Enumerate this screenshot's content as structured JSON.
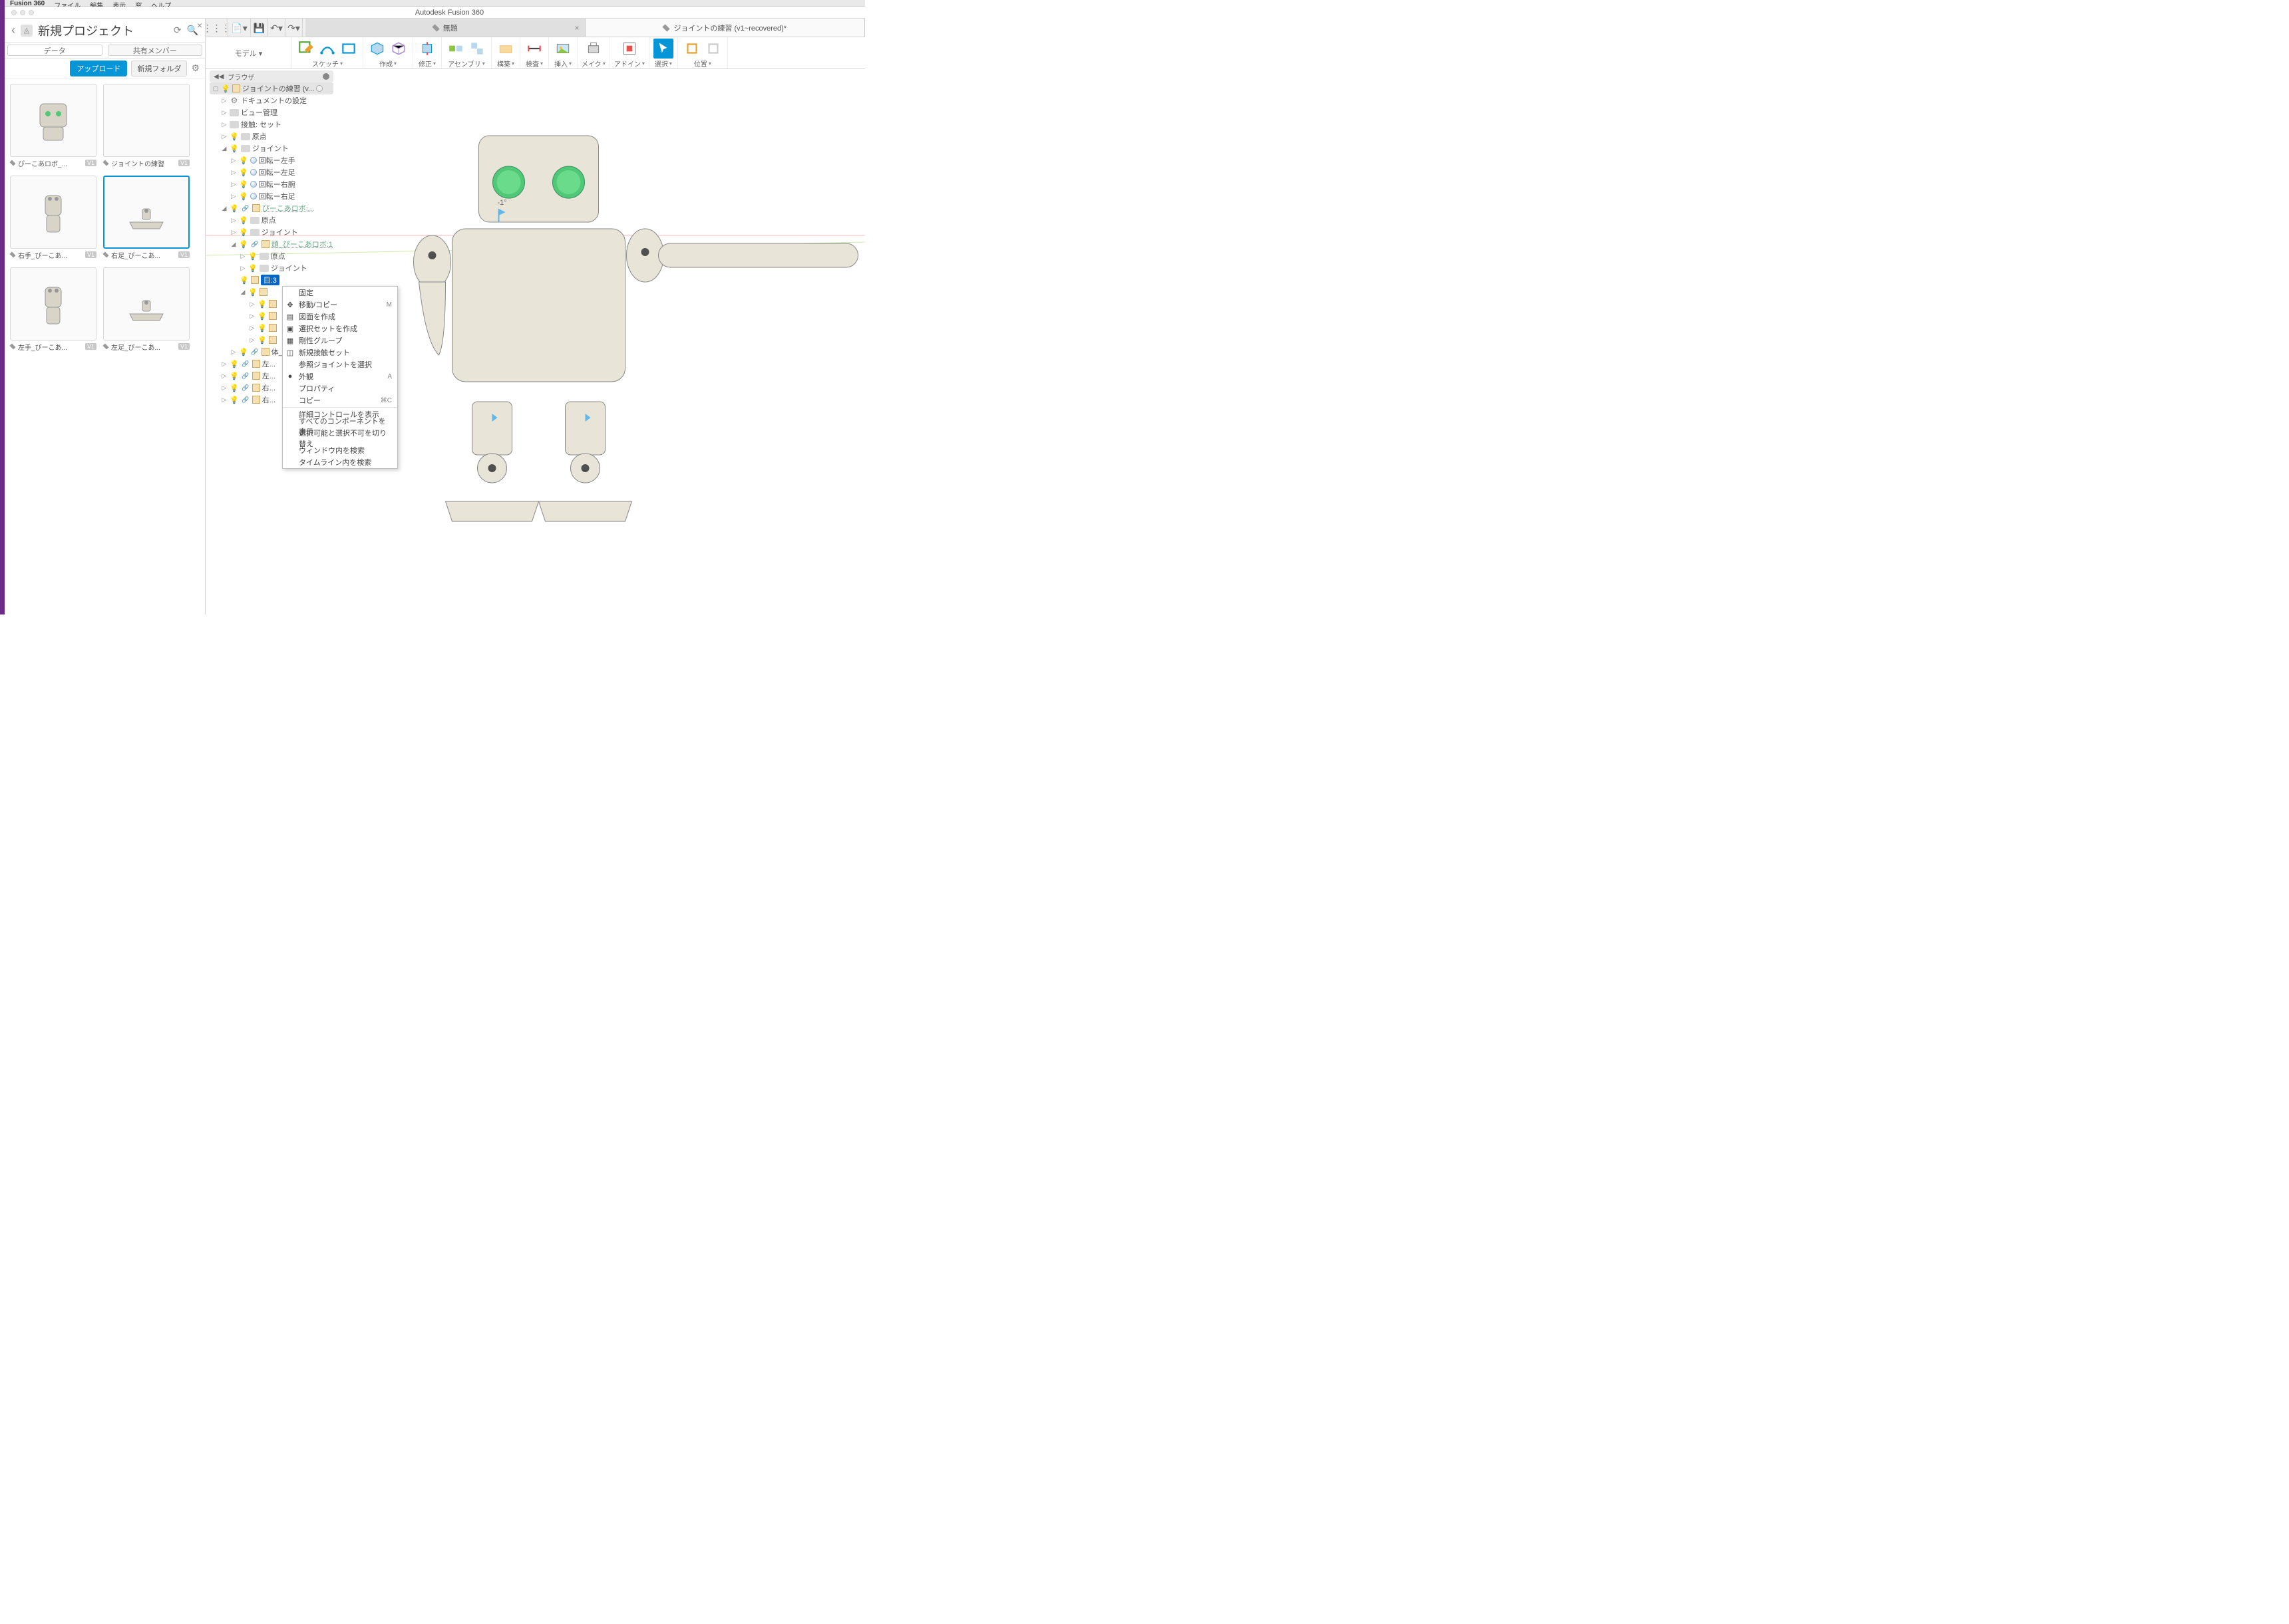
{
  "app": {
    "name": "Fusion 360",
    "window_title": "Autodesk Fusion 360"
  },
  "menubar": [
    "ファイル",
    "編集",
    "表示",
    "窓",
    "ヘルプ"
  ],
  "doc_tabs": [
    {
      "label": "無題",
      "active": false
    },
    {
      "label": "ジョイントの練習 (v1~recovered)*",
      "active": true
    }
  ],
  "workspace": "モデル ▾",
  "ribbon_groups": [
    {
      "label": "スケッチ"
    },
    {
      "label": "作成"
    },
    {
      "label": "修正"
    },
    {
      "label": "アセンブリ"
    },
    {
      "label": "構築"
    },
    {
      "label": "検査"
    },
    {
      "label": "挿入"
    },
    {
      "label": "メイク"
    },
    {
      "label": "アドイン"
    },
    {
      "label": "選択"
    },
    {
      "label": "位置"
    }
  ],
  "data_panel": {
    "project_title": "新規プロジェクト",
    "tabs": {
      "data": "データ",
      "members": "共有メンバー"
    },
    "upload": "アップロード",
    "new_folder": "新規フォルダ",
    "items": [
      {
        "name": "ぴーこあロボ_...",
        "ver": "V1",
        "kind": "robot-head"
      },
      {
        "name": "ジョイントの練習",
        "ver": "V1",
        "kind": "blank"
      },
      {
        "name": "右手_ぴーこあ...",
        "ver": "V1",
        "kind": "arm"
      },
      {
        "name": "右足_ぴーこあ...",
        "ver": "V1",
        "kind": "foot",
        "selected": true
      },
      {
        "name": "左手_ぴーこあ...",
        "ver": "V1",
        "kind": "arm"
      },
      {
        "name": "左足_ぴーこあ...",
        "ver": "V1",
        "kind": "foot"
      }
    ]
  },
  "browser": {
    "title": "ブラウザ",
    "root": "ジョイントの練習 (v...",
    "nodes": {
      "doc_settings": "ドキュメントの設定",
      "view_mgmt": "ビュー管理",
      "contact_set": "接触: セット",
      "origin": "原点",
      "joints": "ジョイント",
      "j_rot_lh": "回転ー左手",
      "j_rot_lf": "回転ー左足",
      "j_rot_rh": "回転ー右腕",
      "j_rot_rf": "回転ー右足",
      "comp_robo": "ぴーこあロボ:...",
      "comp_origin": "原点",
      "comp_joint": "ジョイント",
      "comp_head": "頭_ぴーこあロボ:1",
      "head_origin": "原点",
      "head_joint": "ジョイント",
      "head_eye": "目:3",
      "body": "体_...",
      "l_": "左...",
      "r_": "右..."
    }
  },
  "context_menu": [
    {
      "label": "固定"
    },
    {
      "label": "移動/コピー",
      "icon": "move",
      "shortcut": "M"
    },
    {
      "label": "図面を作成",
      "icon": "drawing"
    },
    {
      "label": "選択セットを作成",
      "icon": "selset"
    },
    {
      "label": "剛性グループ",
      "icon": "rigid"
    },
    {
      "label": "新規接触セット",
      "icon": "contact"
    },
    {
      "label": "参照ジョイントを選択"
    },
    {
      "label": "外観",
      "icon": "appearance",
      "shortcut": "A"
    },
    {
      "label": "プロパティ"
    },
    {
      "label": "コピー",
      "shortcut": "⌘C"
    },
    {
      "sep": true
    },
    {
      "label": "詳細コントロールを表示"
    },
    {
      "label": "すべてのコンポーネントを表示"
    },
    {
      "label": "選択可能と選択不可を切り替え"
    },
    {
      "label": "ウィンドウ内を検索"
    },
    {
      "label": "タイムライン内を検索"
    }
  ],
  "angle_label": "-1°"
}
